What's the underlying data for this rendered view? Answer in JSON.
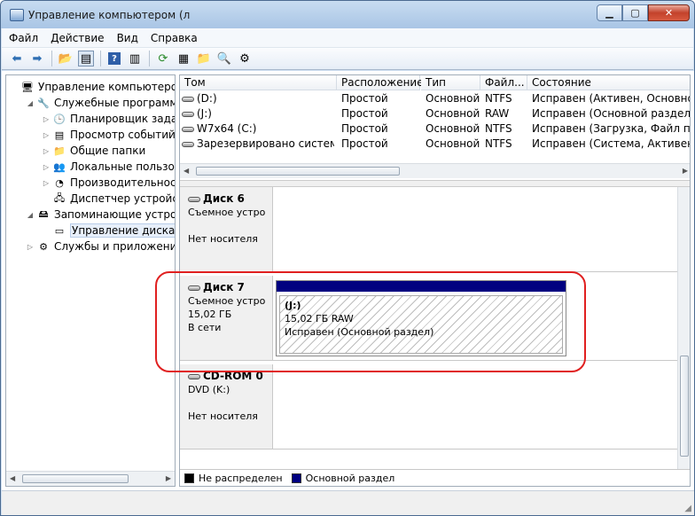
{
  "window": {
    "title": "Управление компьютером (л"
  },
  "menu": [
    "Файл",
    "Действие",
    "Вид",
    "Справка"
  ],
  "tree": [
    {
      "label": "Управление компьютером (л",
      "level": 0,
      "tri": "",
      "icon": "computer-icon"
    },
    {
      "label": "Служебные программы",
      "level": 1,
      "tri": "◢",
      "icon": "tools-icon"
    },
    {
      "label": "Планировщик заданий",
      "level": 2,
      "tri": "▷",
      "icon": "clock-icon"
    },
    {
      "label": "Просмотр событий",
      "level": 2,
      "tri": "▷",
      "icon": "event-viewer-icon"
    },
    {
      "label": "Общие папки",
      "level": 2,
      "tri": "▷",
      "icon": "shared-folder-icon"
    },
    {
      "label": "Локальные пользовате",
      "level": 2,
      "tri": "▷",
      "icon": "users-icon"
    },
    {
      "label": "Производительность",
      "level": 2,
      "tri": "▷",
      "icon": "performance-icon"
    },
    {
      "label": "Диспетчер устройств",
      "level": 2,
      "tri": "",
      "icon": "device-manager-icon"
    },
    {
      "label": "Запоминающие устройст",
      "level": 1,
      "tri": "◢",
      "icon": "storage-icon"
    },
    {
      "label": "Управление дисками",
      "level": 2,
      "tri": "",
      "icon": "disk-management-icon",
      "selected": true
    },
    {
      "label": "Службы и приложения",
      "level": 1,
      "tri": "▷",
      "icon": "services-icon"
    }
  ],
  "volumes": {
    "headers": [
      "Том",
      "Расположение",
      "Тип",
      "Файл...",
      "Состояние"
    ],
    "rows": [
      [
        "(D:)",
        "Простой",
        "Основной",
        "NTFS",
        "Исправен (Активен, Основной р"
      ],
      [
        "(J:)",
        "Простой",
        "Основной",
        "RAW",
        "Исправен (Основной раздел)"
      ],
      [
        "W7x64 (C:)",
        "Простой",
        "Основной",
        "NTFS",
        "Исправен (Загрузка, Файл подк"
      ],
      [
        "Зарезервировано системой",
        "Простой",
        "Основной",
        "NTFS",
        "Исправен (Система, Активен, Ос"
      ]
    ]
  },
  "disks": [
    {
      "name": "Диск 6",
      "line1": "Съемное устро",
      "line2": "",
      "line3": "Нет носителя"
    },
    {
      "name": "Диск 7",
      "line1": "Съемное устро",
      "line2": "15,02 ГБ",
      "line3": "В сети",
      "partition": {
        "title": "(J:)",
        "size": "15,02 ГБ RAW",
        "status": "Исправен (Основной раздел)"
      }
    },
    {
      "name": "CD-ROM 0",
      "line1": "DVD (K:)",
      "line2": "",
      "line3": "Нет носителя"
    }
  ],
  "legend": [
    {
      "label": "Не распределен",
      "color": "#000000"
    },
    {
      "label": "Основной раздел",
      "color": "#000080"
    }
  ]
}
